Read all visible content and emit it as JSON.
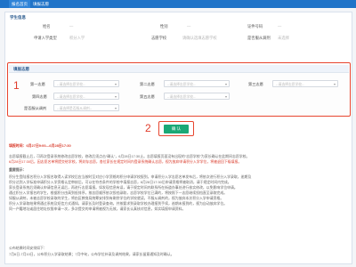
{
  "tabs": [
    "报名首页",
    "填报志愿"
  ],
  "student_info": {
    "title": "学生信息",
    "fields": [
      {
        "label": "姓名",
        "value": "—"
      },
      {
        "label": "性别",
        "value": "—"
      },
      {
        "label": "证件号码",
        "value": "—"
      },
      {
        "label": "申请入学类型",
        "value": "积分入学"
      },
      {
        "label": "志愿学校",
        "value": "请确认选填志愿学校"
      },
      {
        "label": "是否服从调剂",
        "value": "未选择"
      }
    ]
  },
  "choices": {
    "title": "填报志愿",
    "placeholder": "--请选择志愿学校--",
    "first": "第一志愿",
    "second": "第二志愿",
    "third": "第三志愿",
    "fourth": "第四志愿",
    "fifth": "第五志愿",
    "sixth": "第六志愿",
    "adjust": "是否服从调剂",
    "adjust_placeholder": "--请选择是否服从调剂--"
  },
  "markers": {
    "one": "1",
    "two": "2"
  },
  "submit_label": "确 认",
  "notice": {
    "time": "填报时间：6月27日9:00—6月28日17:30",
    "lines": [
      "志愿填报截止后，可再次登录系统修改志愿学校，修改后须点击“确认”，6月28日17:30止。志愿填报页面没有出现的“志愿学校”为家长确认在此期间志愿学校。",
      "6月28日17:30后，因志愿名单将提交给学校，将封存志愿，各位家长在规定时间内登录系统确认志愿，视为放弃申请积分入学学位，将被退回下级填报。",
      "重要提示：",
      "积分生登陆报名积分入学报名取得入读学校后应当按时至对应小学资格的积分申请学校报到，申请积分入学志愿名单发布后，将依次进行积分入学录取，逾期及",
      "积分达到入学标准申请积分入学资格认定审核后，可以在符合条件的学校中填报志愿，6月28日17:30后申请资格将被取消，请于规定时间内完成。",
      "家长登录系统后须确认申请信息无误后，再进行志愿填报。如发现信息有误，请于规定时间内联系所在街道办事处进行核实修改，以免影响学位申请。",
      "通过积分入学报名的学生，根据积分由高到低排序，按志愿顺序依次投档录取，志愿学校学位已满的，将按照下一志愿继续投档直至录取完成。",
      "如服从调剂，未被志愿学校录取的学生，将由区教育局统筹安排到有剩余学位的学校就读，不服从调剂的，视为放弃本次积分入学申请资格。",
      "积分入学录取结果将通过系统及短信方式通知，请家长及时登录查询，并按要求到录取学校办理报到手续，逾期未报到的，视为自动放弃学位。",
      "同一户籍地址或居住地址仅限申请一次，多次提交的申请将被视为无效，请家长认真核对信息，如实填报申请资料。",
      "",
      "公布结果时间安排如下：",
      "7月6日-7月10日，公布积分入学录取结果；7月中旬，公布学位补录及调剂结果，请家长留意通知及时确认。"
    ]
  },
  "colors": {
    "brand": "#1f73c8",
    "highlight": "#e7452f",
    "submit": "#1ba876",
    "notice_red": "#d93b2b"
  }
}
